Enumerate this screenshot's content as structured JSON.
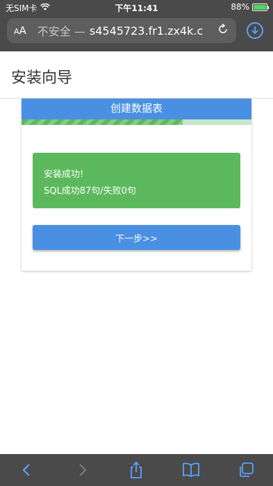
{
  "status_bar": {
    "carrier": "无SIM卡",
    "time": "下午11:41",
    "battery": "88%",
    "battery_level": 0.88
  },
  "browser": {
    "aa_label_small": "A",
    "aa_label_large": "A",
    "insecure_label": "不安全 —",
    "url": "s4545723.fr1.zx4k.c",
    "icons": [
      "wifi-icon",
      "reload-icon",
      "download-icon",
      "back-icon",
      "forward-icon",
      "share-icon",
      "bookmarks-icon",
      "tabs-icon"
    ]
  },
  "page": {
    "title": "安装向导"
  },
  "card": {
    "step_title": "创建数据表",
    "progress": 0.7,
    "alert": {
      "line1": "安装成功!",
      "line2": "SQL成功87句/失败0句"
    },
    "next_button": "下一步>>"
  },
  "colors": {
    "primary": "#4a90e2",
    "success": "#5cb85c",
    "chrome": "#4a4a4a",
    "link_blue": "#5aa4ff"
  }
}
